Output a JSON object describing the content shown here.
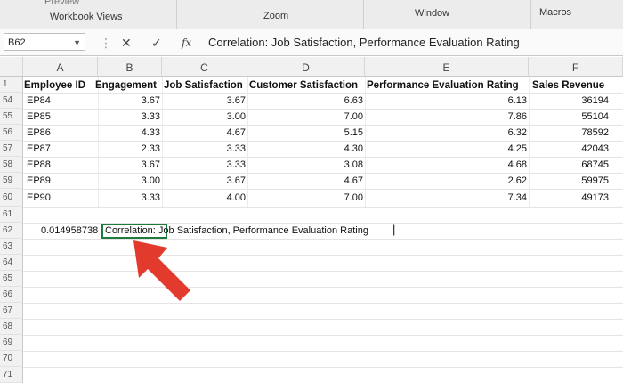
{
  "ribbon": {
    "preview_label": "Preview",
    "workbook_views_label": "Workbook Views",
    "zoom_label": "Zoom",
    "window_label": "Window",
    "macros_label": "Macros"
  },
  "formula_bar": {
    "name_box": "B62",
    "formula": "Correlation: Job Satisfaction, Performance Evaluation Rating",
    "fx_label": "fx"
  },
  "columns": [
    "A",
    "B",
    "C",
    "D",
    "E",
    "F"
  ],
  "header_row": {
    "row_number": "1",
    "cells": [
      "Employee ID",
      "Engagement",
      "Job Satisfaction",
      "Customer Satisfaction",
      "Performance Evaluation Rating",
      "Sales Revenue"
    ]
  },
  "rows": [
    {
      "row": "54",
      "cells": [
        "EP84",
        "3.67",
        "3.67",
        "6.63",
        "6.13",
        "36194"
      ]
    },
    {
      "row": "55",
      "cells": [
        "EP85",
        "3.33",
        "3.00",
        "7.00",
        "7.86",
        "55104"
      ]
    },
    {
      "row": "56",
      "cells": [
        "EP86",
        "4.33",
        "4.67",
        "5.15",
        "6.32",
        "78592"
      ]
    },
    {
      "row": "57",
      "cells": [
        "EP87",
        "2.33",
        "3.33",
        "4.30",
        "4.25",
        "42043"
      ]
    },
    {
      "row": "58",
      "cells": [
        "EP88",
        "3.67",
        "3.33",
        "3.08",
        "4.68",
        "68745"
      ]
    },
    {
      "row": "59",
      "cells": [
        "EP89",
        "3.00",
        "3.67",
        "4.67",
        "2.62",
        "59975"
      ]
    },
    {
      "row": "60",
      "cells": [
        "EP90",
        "3.33",
        "4.00",
        "7.00",
        "7.34",
        "49173"
      ]
    }
  ],
  "row61": {
    "row": "61"
  },
  "row62": {
    "row": "62",
    "a_value": "0.014958738",
    "b_value": "Correlation: Job Satisfaction, Performance Evaluation Rating"
  },
  "empty_rows": [
    "63",
    "64",
    "65",
    "66",
    "67",
    "68",
    "69",
    "70",
    "71"
  ],
  "colors": {
    "selection": "#1f7a3c",
    "arrow": "#e23b2e"
  }
}
